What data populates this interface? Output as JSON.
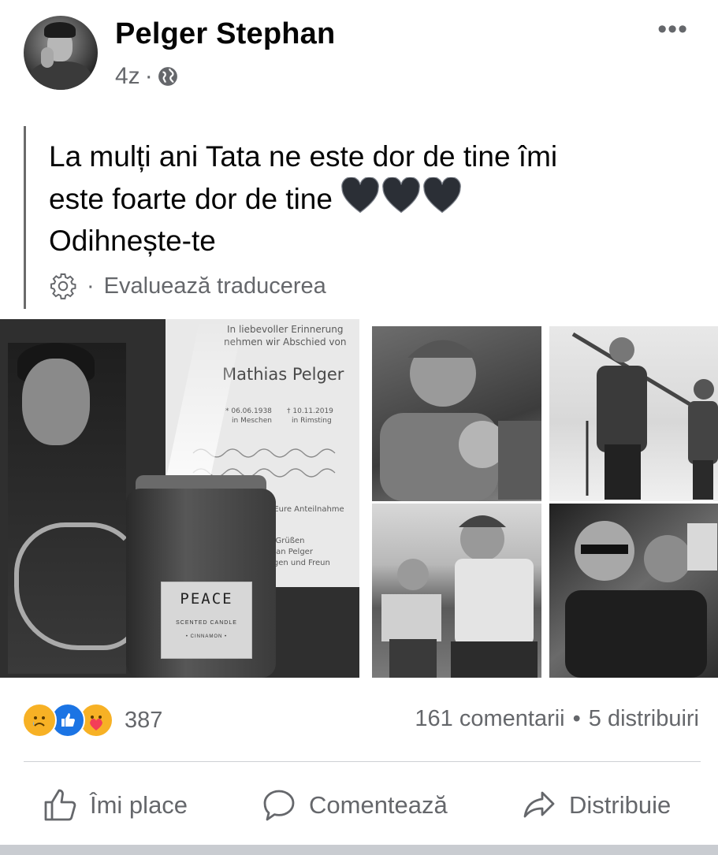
{
  "post": {
    "author": "Pelger Stephan",
    "time": "4z",
    "separator": "·",
    "text_line1": "La mulți ani Tata ne este dor de tine îmi",
    "text_line2": "este foarte dor de tine",
    "text_line3": "Odihnește-te",
    "translate_bullet": "·",
    "translate_label": "Evaluează traducerea",
    "icons": [
      "more-icon",
      "globe-icon",
      "black-heart-icon",
      "gear-icon"
    ]
  },
  "photos": {
    "card": {
      "line1": "In liebevoller Erinnerung",
      "line2": "nehmen wir Abschied von",
      "name": "Mathias Pelger",
      "birth": "* 06.06.1938",
      "death": "† 10.11.2019",
      "birth_place": "in Meschen",
      "death_place": "in Rimsting",
      "thanks": "r Eure Anteilnahme",
      "greet1": "n Grüßen",
      "greet2": "etan Pelger",
      "greet3": "rigen und Freun"
    },
    "candle": {
      "label_title": "PEACE",
      "label_sub": "SCENTED CANDLE",
      "label_scent": "• CINNAMON •"
    }
  },
  "reactions": {
    "types": [
      "sad",
      "like",
      "care"
    ],
    "count": "387",
    "comments": "161 comentarii",
    "dot": "•",
    "shares": "5 distribuiri"
  },
  "actions": {
    "like": "Îmi place",
    "comment": "Comentează",
    "share": "Distribuie"
  },
  "colors": {
    "text_primary": "#050505",
    "text_secondary": "#65676b",
    "like_blue": "#1b74e4",
    "reaction_yellow": "#f7b125",
    "divider": "#ced0d4"
  }
}
